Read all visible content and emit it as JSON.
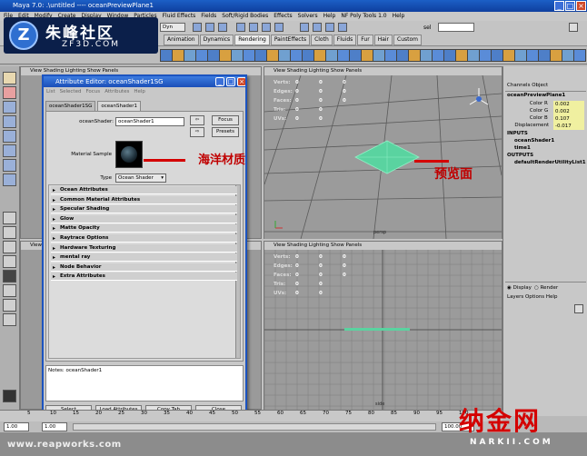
{
  "window": {
    "title": "Maya 7.0: .\\untitled   ----   oceanPreviewPlane1"
  },
  "menubar": [
    "File",
    "Edit",
    "Modify",
    "Create",
    "Display",
    "Window",
    "Particles",
    "Fluid Effects",
    "Fields",
    "Soft/Rigid Bodies",
    "Effects",
    "Solvers",
    "Help",
    "NF Poly Tools 1.0",
    "Help"
  ],
  "logo": {
    "cn": "朱峰社区",
    "en": "ZF3D.COM"
  },
  "toolbar": {
    "mode": "Dyn",
    "sel": "sel"
  },
  "shelf_tabs": [
    "Animation",
    "Dynamics",
    "Rendering",
    "PaintEffects",
    "Cloth",
    "Fluids",
    "Fur",
    "Hair",
    "Custom"
  ],
  "viewport_menu": "View  Shading  Lighting  Show  Panels",
  "hud": {
    "labels": [
      "Verts:",
      "Edges:",
      "Faces:",
      "Tris:",
      "UVs:"
    ],
    "col1": [
      "0",
      "0",
      "0",
      "0",
      "0"
    ],
    "col2": [
      "0",
      "0",
      "0",
      "0",
      "0"
    ],
    "col3": [
      "0",
      "0",
      "0",
      "0",
      "0"
    ]
  },
  "views": {
    "persp": "persp",
    "side": "side"
  },
  "attribute_editor": {
    "title": "Attribute Editor: oceanShader1SG",
    "menu": [
      "List",
      "Selected",
      "Focus",
      "Attributes",
      "Help"
    ],
    "tabs": [
      "oceanShader1SG",
      "oceanShader1"
    ],
    "shader_label": "oceanShader:",
    "shader_value": "oceanShader1",
    "focus_btn": "Focus",
    "presets_btn": "Presets",
    "sample_label": "Material Sample",
    "type_label": "Type",
    "type_value": "Ocean Shader",
    "sections": [
      "Ocean Attributes",
      "Common Material Attributes",
      "Specular Shading",
      "Glow",
      "Matte Opacity",
      "Raytrace Options",
      "Hardware Texturing",
      "mental ray",
      "Node Behavior",
      "Extra Attributes"
    ],
    "notes_label": "Notes:  oceanShader1",
    "buttons": [
      "Select",
      "Load Attributes",
      "Copy Tab",
      "Close"
    ]
  },
  "annotations": {
    "material": "海洋材质",
    "preview": "预览面"
  },
  "channel_box": {
    "menu": "Channels  Object",
    "node": "oceanPreviewPlane1",
    "attrs": [
      {
        "name": "Color R",
        "value": "0.002"
      },
      {
        "name": "Color G",
        "value": "0.002"
      },
      {
        "name": "Color B",
        "value": "0.107"
      },
      {
        "name": "Displacement",
        "value": "-0.017"
      }
    ],
    "inputs_hdr": "INPUTS",
    "inputs": [
      "oceanShader1",
      "time1"
    ],
    "outputs_hdr": "OUTPUTS",
    "outputs": [
      "defaultRenderUtilityList1"
    ],
    "display_opt": "Display",
    "render_opt": "Render",
    "layers_menu": "Layers  Options  Help"
  },
  "timeline": {
    "ticks": [
      "5",
      "10",
      "15",
      "20",
      "25",
      "30",
      "35",
      "40",
      "45",
      "50",
      "55",
      "60",
      "65",
      "70",
      "75",
      "80",
      "85",
      "90",
      "95",
      "100"
    ],
    "start": "1.00",
    "end": "1.00",
    "range_end": "100.00"
  },
  "watermark": "www.reapworks.com",
  "narkii": {
    "cn": "纳金网",
    "en": "NARKII.COM"
  },
  "colors": {
    "title_blue": "#1b4fb8",
    "annotation_red": "#d40000",
    "preview_green": "#5ad3a0"
  }
}
